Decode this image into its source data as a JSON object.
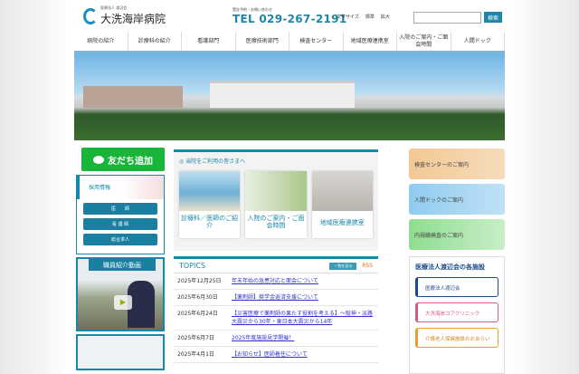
{
  "header": {
    "corp": "医療法人 渡辺会",
    "name": "大洗海岸病院",
    "tel_label": "受診予約・お問い合わせ",
    "tel": "TEL 029-267-2191",
    "font_size_label": "文字サイズ",
    "font_normal": "標準",
    "font_large": "拡大",
    "search_placeholder": "",
    "search_button": "検索"
  },
  "nav": [
    "病院の紹介",
    "診療科の紹介",
    "看護部門",
    "医療技術部門",
    "検査センター",
    "地域医療連携室",
    "入院のご案内・ご面会時間",
    "人間ドック"
  ],
  "left": {
    "line": "友だち追加",
    "recruit_title": "採用情報",
    "recruit_buttons": [
      "医　　師",
      "看 護 師",
      "総合求人"
    ],
    "video_title": "職員紹介動画"
  },
  "visitors": {
    "title": "当院をご利用の皆さまへ",
    "cards": [
      "診療科／医師のご紹介",
      "入院のご案内・ご面会時間",
      "地域医療連携室"
    ]
  },
  "topics": {
    "title": "TOPICS",
    "all": "一覧を見る",
    "rss": "RSS",
    "items": [
      {
        "date": "2025年12月25日",
        "text": "年末年始の急患対応と面会について"
      },
      {
        "date": "2025年6月30日",
        "text": "【薬剤師】奨学金返済支援について"
      },
      {
        "date": "2025年6月24日",
        "text": "【災害医療で薬剤師の果たす役割を考える】～阪神・淡路大震災から30年・東日本大震災から14年"
      },
      {
        "date": "2025年6月7日",
        "text": "2025年度施設見学開催！"
      },
      {
        "date": "2025年4月1日",
        "text": "【お知らせ】医師着任について"
      }
    ]
  },
  "right": {
    "banners": [
      "検査センターのご案内",
      "人間ドックのご案内",
      "内視鏡検査のご案内"
    ],
    "facilities_title": "医療法人渡辺会の各施設",
    "facilities": [
      "医療法人渡辺会",
      "大洗海岸コアクリニック",
      "介護老人保健施設おおあらい"
    ]
  }
}
